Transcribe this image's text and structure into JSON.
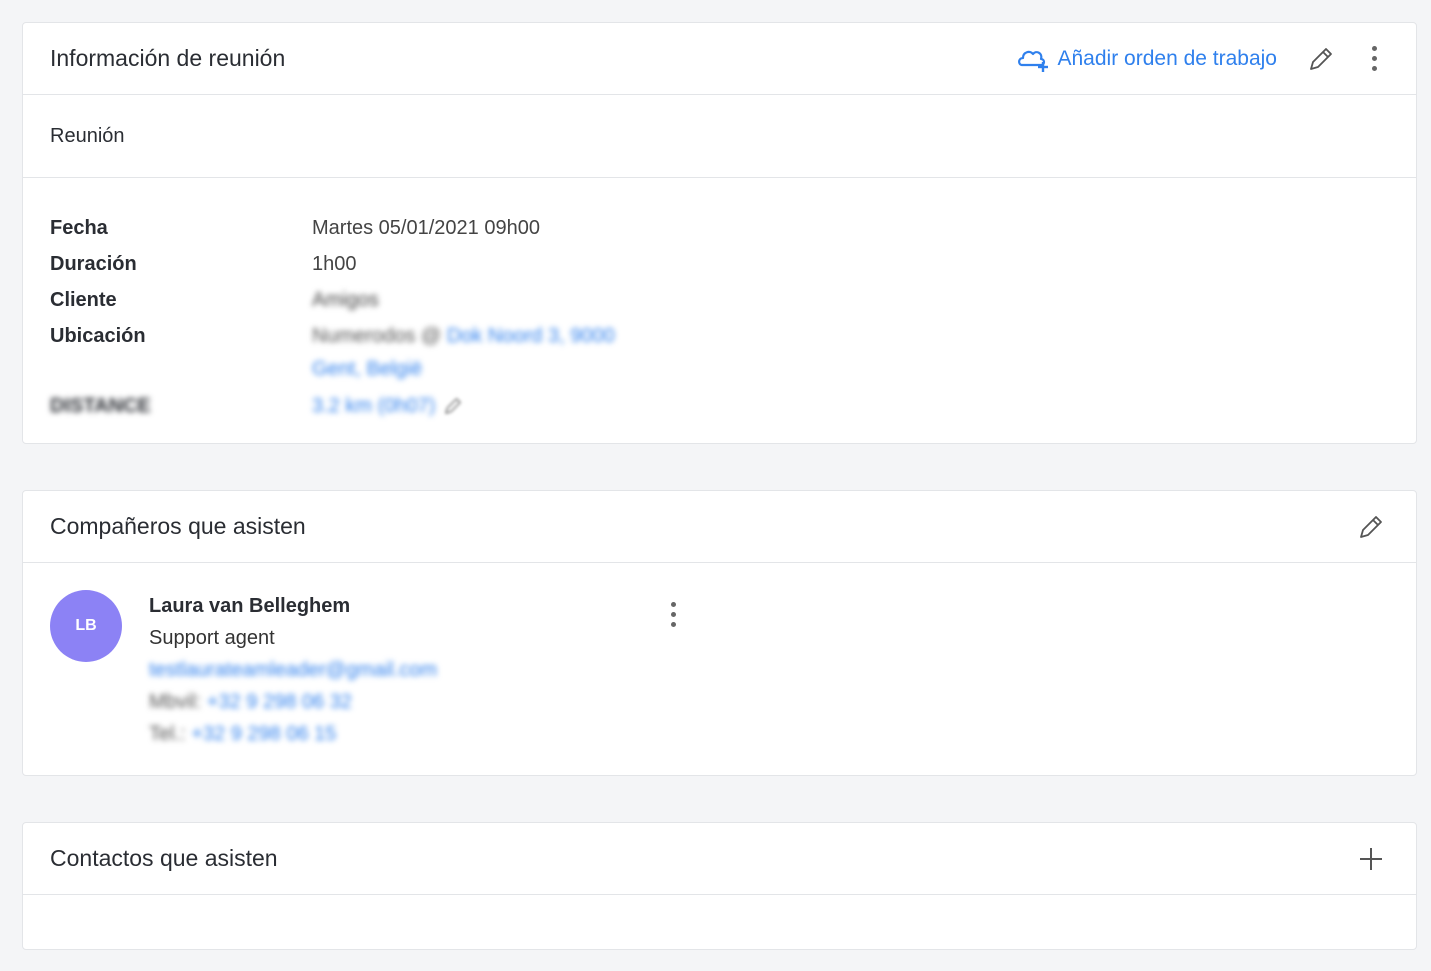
{
  "meeting_card": {
    "title": "Información de reunión",
    "add_order_label": "Añadir orden de trabajo",
    "subtitle": "Reunión",
    "fields": [
      {
        "label": "Fecha",
        "value": "Martes 05/01/2021 09h00"
      },
      {
        "label": "Duración",
        "value": "1h00"
      },
      {
        "label": "Cliente",
        "value": "Amigos"
      },
      {
        "label": "Ubicación",
        "value_prefix": "Numerodos @",
        "value_link": "Dok Noord 3, 9000",
        "value_link2": "Gent, België"
      },
      {
        "label": "DISTANCE",
        "value": "3.2 km (0h07)"
      }
    ]
  },
  "colleagues_card": {
    "title": "Compañeros que asisten",
    "person": {
      "initials": "LB",
      "name": "Laura van Belleghem",
      "role": "Support agent",
      "email": "testlaurateamleader@gmail.com",
      "mobile_label": "Mbvil:",
      "mobile": "+32 9 298 06 32",
      "phone_label": "Tel.:",
      "phone": "+32 9 298 06 15"
    }
  },
  "contacts_card": {
    "title": "Contactos que asisten"
  },
  "colors": {
    "accent": "#2f80ed",
    "avatar": "#8c82f5",
    "border": "#e3e5e8",
    "background": "#f4f5f7"
  },
  "icons": {
    "add_order": "cloud-plus-icon",
    "edit": "pencil-icon",
    "more": "kebab-icon",
    "add": "plus-icon"
  }
}
